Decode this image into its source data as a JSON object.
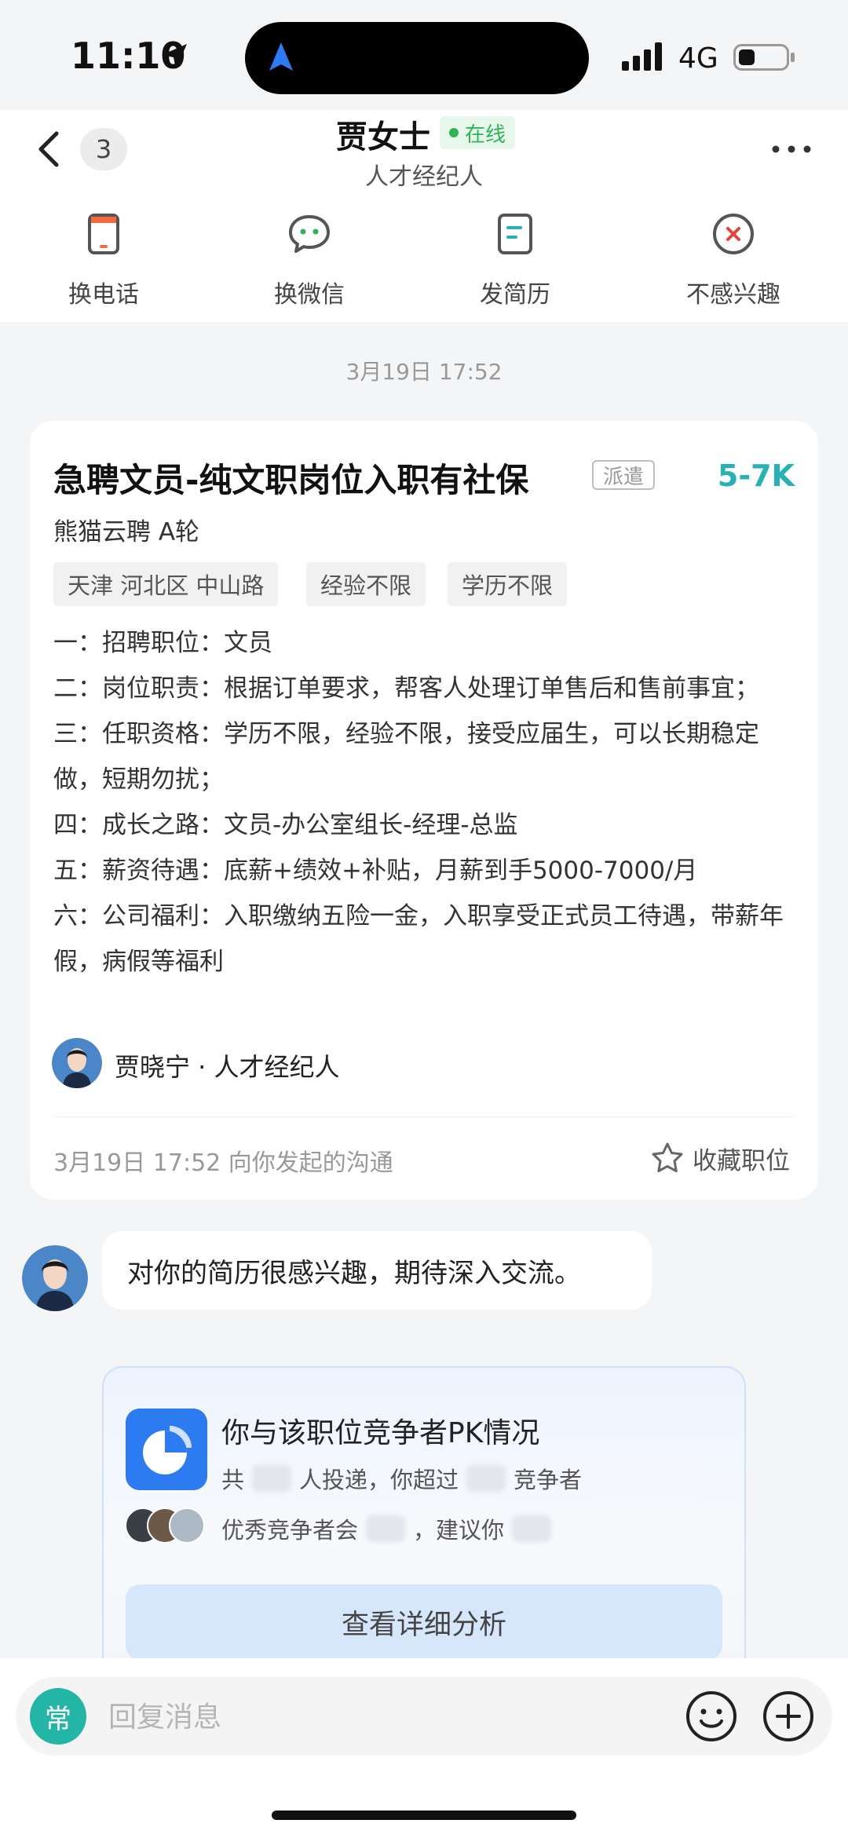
{
  "status_bar": {
    "time": "11:10",
    "network": "4G",
    "icons": [
      "location-arrow-icon",
      "signal-icon",
      "battery-icon"
    ]
  },
  "header": {
    "unread_count": "3",
    "contact_name": "贾女士",
    "online_status": "在线",
    "contact_role": "人才经纪人",
    "actions": [
      {
        "label": "换电话",
        "icon": "phone-icon"
      },
      {
        "label": "换微信",
        "icon": "wechat-icon"
      },
      {
        "label": "发简历",
        "icon": "resume-icon"
      },
      {
        "label": "不感兴趣",
        "icon": "not-interested-icon"
      }
    ]
  },
  "chat": {
    "timestamp": "3月19日 17:52",
    "job_card": {
      "title": "急聘文员-纯文职岗位入职有社保",
      "dispatch_tag": "派遣",
      "salary": "5-7K",
      "company": "熊猫云聘 A轮",
      "tags": [
        "天津 河北区 中山路",
        "经验不限",
        "学历不限"
      ],
      "description": [
        "一：招聘职位：文员",
        "二：岗位职责：根据订单要求，帮客人处理订单售后和售前事宜；",
        "三：任职资格：学历不限，经验不限，接受应届生，可以长期稳定做，短期勿扰；",
        "四：成长之路：文员-办公室组长-经理-总监",
        "五：薪资待遇：底薪+绩效+补贴，月薪到手5000-7000/月",
        "六：公司福利：入职缴纳五险一金，入职享受正式员工待遇，带薪年假，病假等福利"
      ],
      "recruiter": "贾晓宁 · 人才经纪人",
      "footer_text": "3月19日 17:52 向你发起的沟通",
      "favorite_label": "收藏职位"
    },
    "message": "对你的简历很感兴趣，期待深入交流。",
    "pk_card": {
      "title": "你与该职位竞争者PK情况",
      "line1_a": "共",
      "line1_b": "人投递，你超过",
      "line1_c": "竞争者",
      "line2_a": "优秀竞争者会",
      "line2_b": "，建议你",
      "button": "查看详细分析"
    }
  },
  "input_bar": {
    "quick_label": "常",
    "placeholder": "回复消息"
  },
  "colors": {
    "salary": "#26b1b5",
    "online": "#2fb455",
    "accent_blue": "#2c7bf0",
    "quick_reply": "#23b5a5"
  }
}
